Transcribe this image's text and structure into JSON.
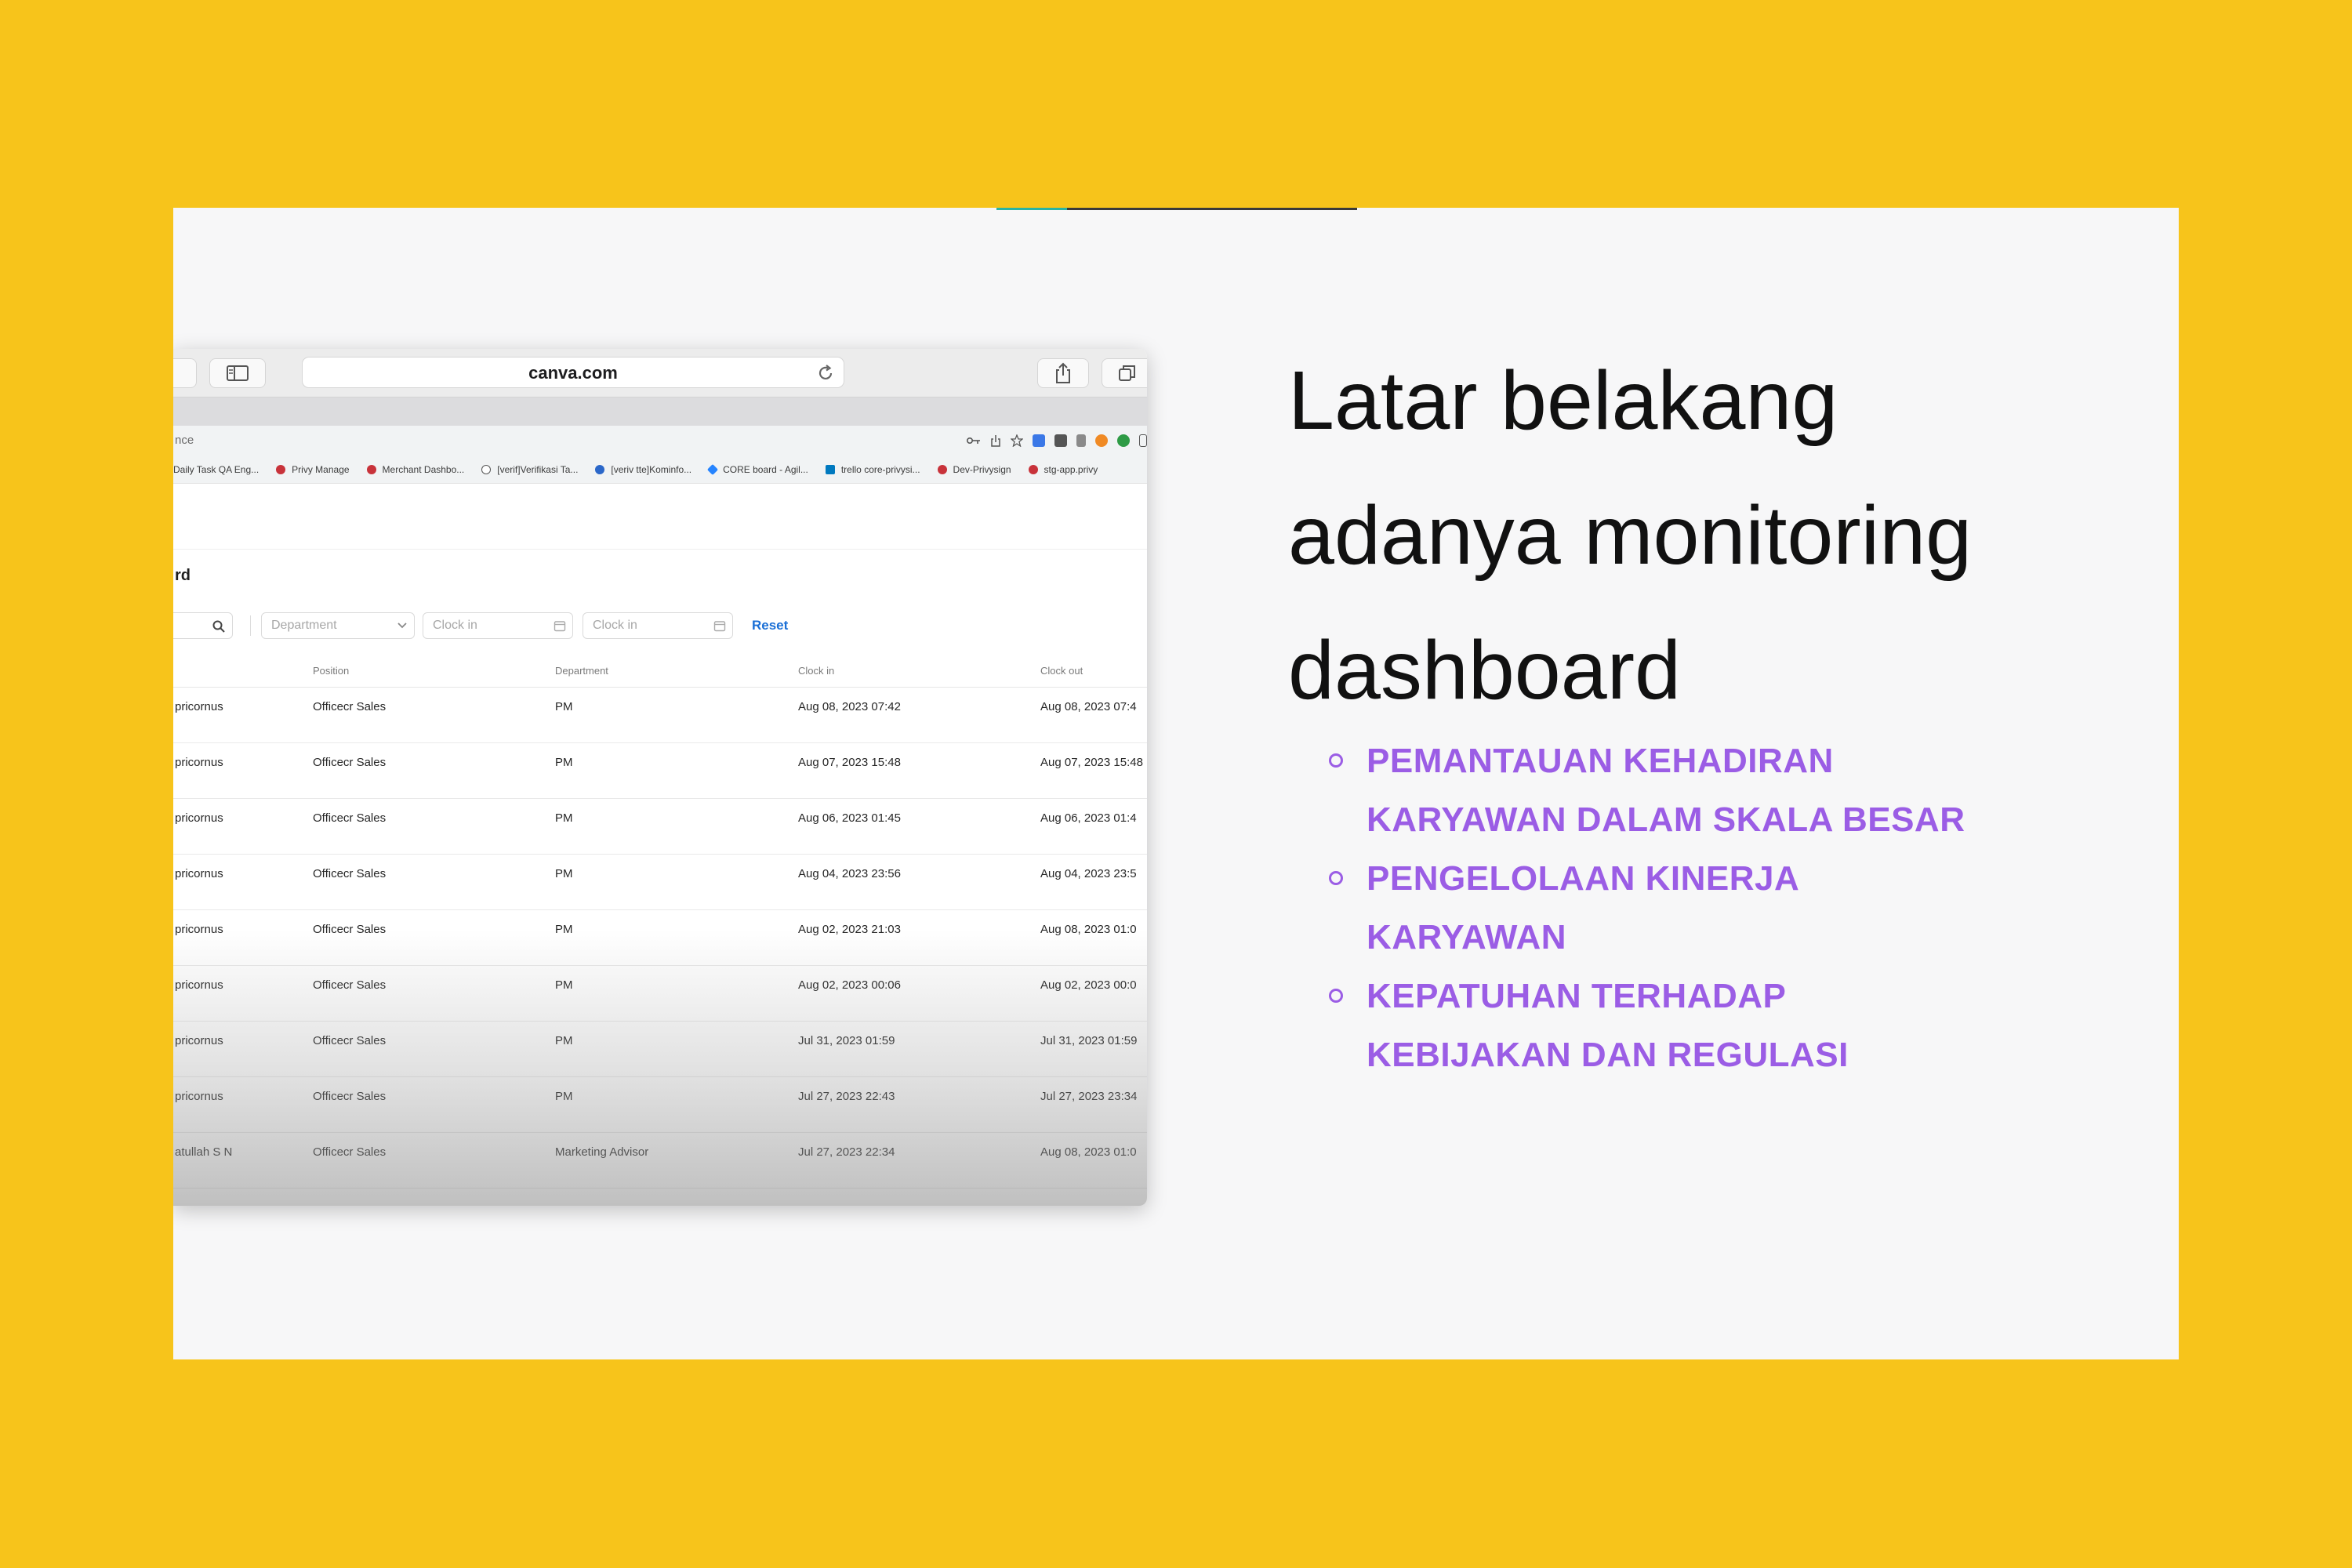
{
  "colors": {
    "background": "#f7c41b",
    "slide": "#f7f7f8",
    "heading": "#111111",
    "bullets": "#9b5de5",
    "link": "#1a6fd6"
  },
  "browser": {
    "url": "canva.com",
    "address_fragment": "nce",
    "bookmarks": [
      {
        "label": "Daily Task QA Eng...",
        "icon": "none"
      },
      {
        "label": "Privy Manage",
        "icon": "red-leaf-icon"
      },
      {
        "label": "Merchant Dashbo...",
        "icon": "red-leaf-icon"
      },
      {
        "label": "[verif]Verifikasi Ta...",
        "icon": "globe-icon"
      },
      {
        "label": "[veriv tte]Kominfo...",
        "icon": "blue-globe-icon"
      },
      {
        "label": "CORE board - Agil...",
        "icon": "blue-diamond-icon"
      },
      {
        "label": "trello core-privysi...",
        "icon": "trello-icon"
      },
      {
        "label": "Dev-Privysign",
        "icon": "red-leaf-icon"
      },
      {
        "label": "stg-app.privy",
        "icon": "red-leaf-icon"
      }
    ]
  },
  "page": {
    "title_fragment": "rd",
    "filters": {
      "department_placeholder": "Department",
      "clock_in_placeholder_1": "Clock in",
      "clock_in_placeholder_2": "Clock in",
      "reset_label": "Reset"
    },
    "table": {
      "headers": [
        "Position",
        "Department",
        "Clock in",
        "Clock out"
      ],
      "rows": [
        {
          "name": "pricornus",
          "position": "Officecr Sales",
          "department": "PM",
          "clock_in": "Aug 08, 2023 07:42",
          "clock_out": "Aug 08, 2023 07:4"
        },
        {
          "name": "pricornus",
          "position": "Officecr Sales",
          "department": "PM",
          "clock_in": "Aug 07, 2023 15:48",
          "clock_out": "Aug 07, 2023 15:48"
        },
        {
          "name": "pricornus",
          "position": "Officecr Sales",
          "department": "PM",
          "clock_in": "Aug 06, 2023 01:45",
          "clock_out": "Aug 06, 2023 01:4"
        },
        {
          "name": "pricornus",
          "position": "Officecr Sales",
          "department": "PM",
          "clock_in": "Aug 04, 2023 23:56",
          "clock_out": "Aug 04, 2023 23:5"
        },
        {
          "name": "pricornus",
          "position": "Officecr Sales",
          "department": "PM",
          "clock_in": "Aug 02, 2023 21:03",
          "clock_out": "Aug 08, 2023 01:0"
        },
        {
          "name": "pricornus",
          "position": "Officecr Sales",
          "department": "PM",
          "clock_in": "Aug 02, 2023 00:06",
          "clock_out": "Aug 02, 2023 00:0"
        },
        {
          "name": "pricornus",
          "position": "Officecr Sales",
          "department": "PM",
          "clock_in": "Jul 31, 2023 01:59",
          "clock_out": "Jul 31, 2023 01:59"
        },
        {
          "name": "pricornus",
          "position": "Officecr Sales",
          "department": "PM",
          "clock_in": "Jul 27, 2023 22:43",
          "clock_out": "Jul 27, 2023 23:34"
        },
        {
          "name": "atullah S N",
          "position": "Officecr Sales",
          "department": "Marketing Advisor",
          "clock_in": "Jul 27, 2023 22:34",
          "clock_out": "Aug 08, 2023 01:0"
        }
      ]
    }
  },
  "slide": {
    "heading_lines": [
      "Latar belakang",
      "adanya monitoring",
      "dashboard"
    ],
    "bullets": [
      [
        "PEMANTAUAN KEHADIRAN",
        "KARYAWAN DALAM SKALA BESAR"
      ],
      [
        "PENGELOLAAN KINERJA",
        "KARYAWAN"
      ],
      [
        "KEPATUHAN TERHADAP",
        "KEBIJAKAN DAN REGULASI"
      ]
    ]
  }
}
